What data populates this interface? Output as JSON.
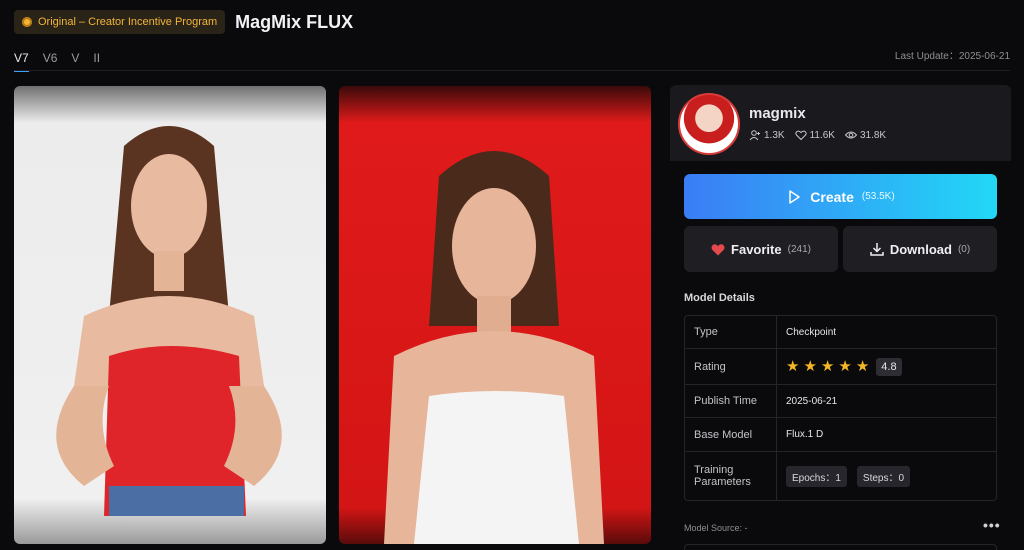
{
  "header": {
    "badge": "Original – Creator Incentive Program",
    "title": "MagMix FLUX",
    "versions": [
      "V7",
      "V6",
      "V",
      "II"
    ],
    "last_update": "Last Update：2025-06-21"
  },
  "author": {
    "name": "magmix",
    "followers": "1.3K",
    "likes": "11.6K",
    "views": "31.8K"
  },
  "actions": {
    "create_label": "Create",
    "create_count": "(53.5K)",
    "favorite_label": "Favorite",
    "favorite_count": "(241)",
    "download_label": "Download",
    "download_count": "(0)"
  },
  "details": {
    "title": "Model Details",
    "type_label": "Type",
    "type_value": "Checkpoint",
    "rating_label": "Rating",
    "rating_value": "4.8",
    "rating_stars": 5,
    "publish_label": "Publish Time",
    "publish_value": "2025-06-21",
    "base_label": "Base Model",
    "base_value": "Flux.1 D",
    "training_label": "Training Parameters",
    "epochs": "Epochs：1",
    "steps": "Steps：0"
  },
  "source": {
    "label": "Model Source: -",
    "more": "•••"
  },
  "colors": {
    "accent": "#3aa0ff",
    "create_start": "#3b7cf5",
    "create_end": "#22d8f6",
    "badge": "#f2b53a",
    "heart": "#e5484d",
    "star": "#f5b625"
  }
}
